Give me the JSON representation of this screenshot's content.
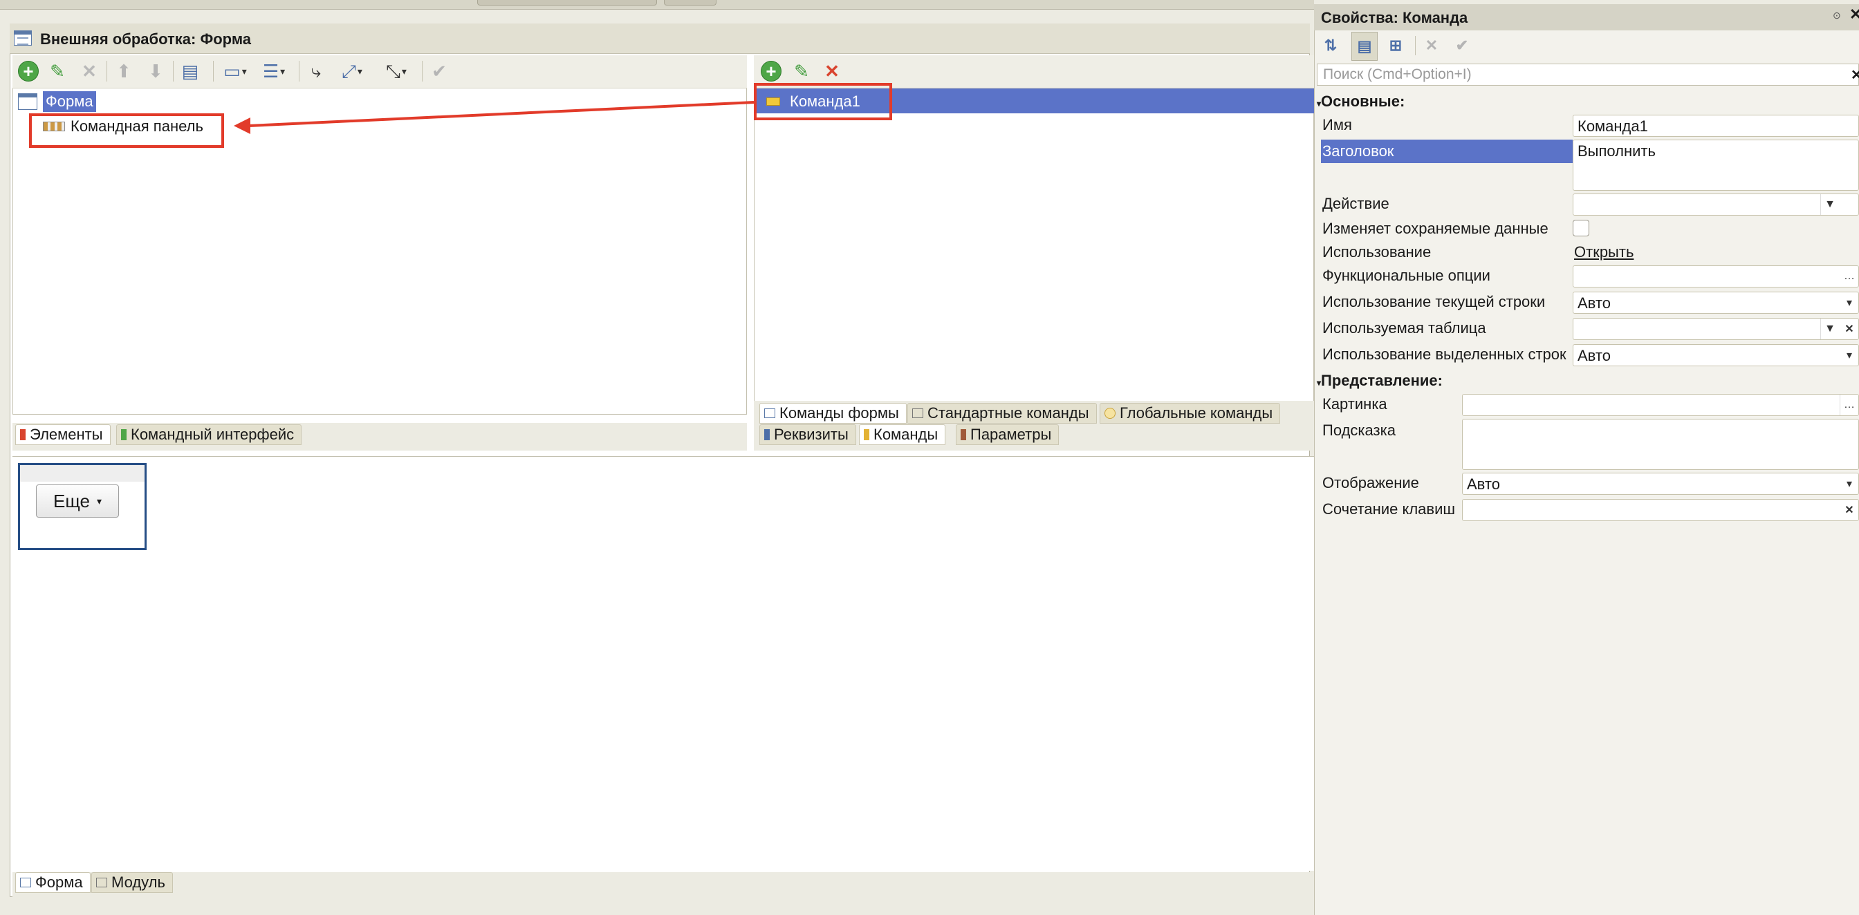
{
  "main_window": {
    "title": "Внешняя обработка: Форма"
  },
  "elements_tree": {
    "root_label": "Форма",
    "child_label": "Командная панель",
    "tabs": [
      {
        "label": "Элементы",
        "active": true
      },
      {
        "label": "Командный интерфейс",
        "active": false
      }
    ]
  },
  "commands_list": {
    "items": [
      {
        "label": "Команда1",
        "selected": true
      }
    ],
    "subtabs": [
      {
        "label": "Команды формы",
        "active": true
      },
      {
        "label": "Стандартные команды",
        "active": false
      },
      {
        "label": "Глобальные команды",
        "active": false
      }
    ],
    "tabs": [
      {
        "label": "Реквизиты",
        "active": false
      },
      {
        "label": "Команды",
        "active": true
      },
      {
        "label": "Параметры",
        "active": false
      }
    ]
  },
  "preview": {
    "more_button": "Еще"
  },
  "bottom_tabs": [
    {
      "label": "Форма",
      "active": true
    },
    {
      "label": "Модуль",
      "active": false
    }
  ],
  "properties": {
    "title": "Свойства: Команда",
    "search_placeholder": "Поиск (Cmd+Option+I)",
    "group_basic": "Основные:",
    "group_view": "Представление:",
    "name_label": "Имя",
    "name_value": "Команда1",
    "header_label": "Заголовок",
    "header_value": "Выполнить",
    "action_label": "Действие",
    "modifies_label": "Изменяет сохраняемые данные",
    "usage_label": "Использование",
    "usage_link": "Открыть",
    "func_options_label": "Функциональные опции",
    "current_row_label": "Использование текущей строки",
    "current_row_value": "Авто",
    "table_label": "Используемая таблица",
    "selected_rows_label": "Использование выделенных строк",
    "selected_rows_value": "Авто",
    "picture_label": "Картинка",
    "tooltip_label": "Подсказка",
    "display_label": "Отображение",
    "display_value": "Авто",
    "shortcut_label": "Сочетание клавиш"
  },
  "colors": {
    "selection": "#5b73c8",
    "annotation": "#e23b2a",
    "add_green": "#4ea647"
  }
}
